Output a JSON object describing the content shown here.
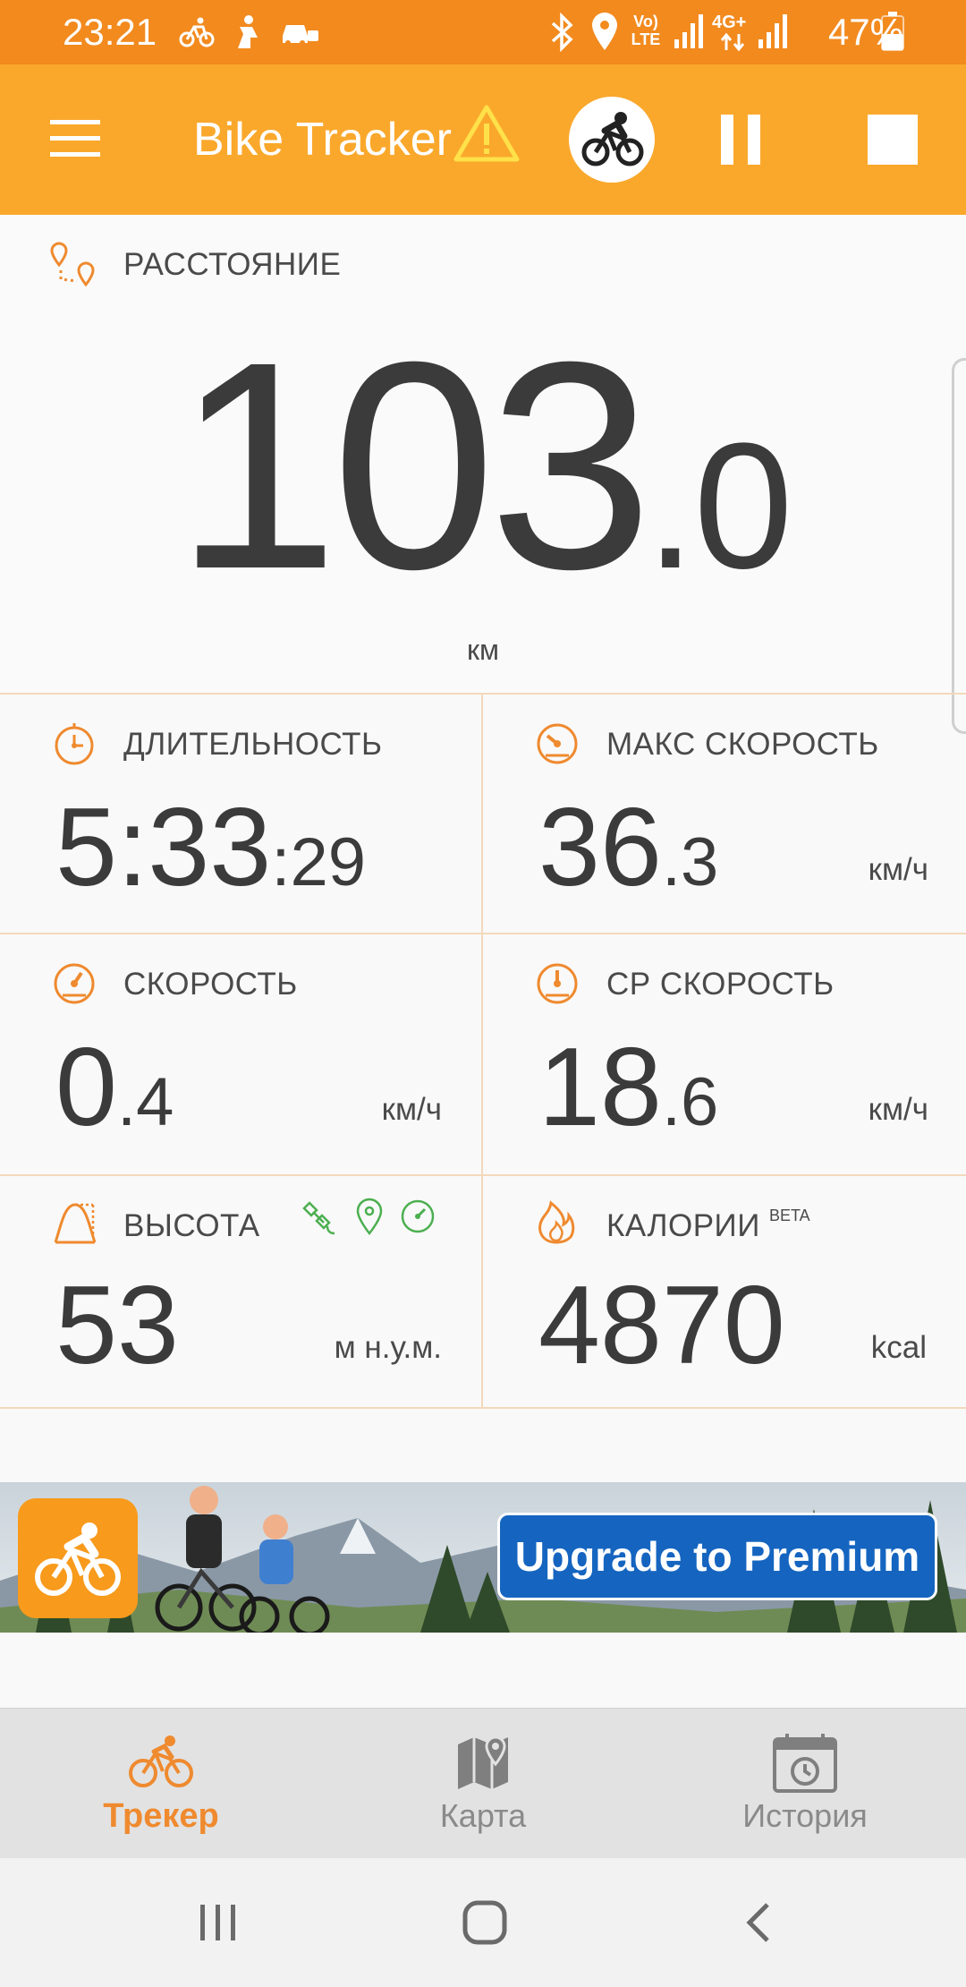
{
  "status_bar": {
    "time": "23:21",
    "battery_text": "47%",
    "network_label": "4G+",
    "volte_label": "Vo) LTE"
  },
  "app_bar": {
    "title": "Bike Tracker"
  },
  "distance": {
    "label": "РАССТОЯНИЕ",
    "value_int": "103",
    "value_dec": ".0",
    "unit": "км"
  },
  "duration": {
    "label": "ДЛИТЕЛЬНОСТЬ",
    "value_main": "5:33",
    "value_sec": ":29"
  },
  "max_speed": {
    "label": "МАКС СКОРОСТЬ",
    "value_int": "36",
    "value_dec": ".3",
    "unit": "км/ч"
  },
  "speed": {
    "label": "СКОРОСТЬ",
    "value_int": "0",
    "value_dec": ".4",
    "unit": "км/ч"
  },
  "avg_speed": {
    "label": "СР СКОРОСТЬ",
    "value_int": "18",
    "value_dec": ".6",
    "unit": "км/ч"
  },
  "altitude": {
    "label": "ВЫСОТА",
    "value": "53",
    "unit": "м н.у.м."
  },
  "calories": {
    "label": "КАЛОРИИ",
    "badge": "BETA",
    "value": "4870",
    "unit": "kcal"
  },
  "banner": {
    "cta": "Upgrade to Premium"
  },
  "bottom_nav": {
    "items": [
      {
        "label": "Трекер",
        "icon": "bike-icon",
        "active": true
      },
      {
        "label": "Карта",
        "icon": "map-icon",
        "active": false
      },
      {
        "label": "История",
        "icon": "calendar-clock-icon",
        "active": false
      }
    ]
  },
  "colors": {
    "accent": "#f28a1e",
    "app_bar": "#faa82c",
    "icon_orange": "#ef8a2f",
    "icon_green": "#4caf50",
    "premium_blue": "#1565c0"
  }
}
